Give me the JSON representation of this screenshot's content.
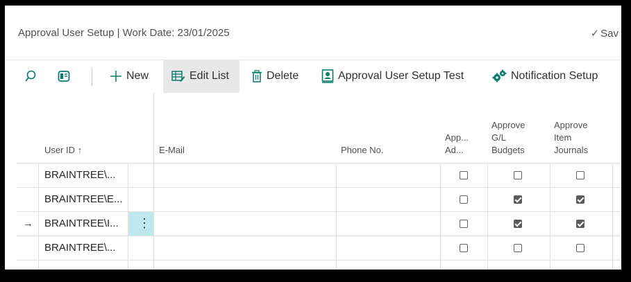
{
  "header": {
    "title": "Approval User Setup | Work Date: 23/01/2025",
    "save_label": "Sav"
  },
  "toolbar": {
    "new_label": "New",
    "edit_list_label": "Edit List",
    "delete_label": "Delete",
    "approval_test_label": "Approval User Setup Test",
    "notification_label": "Notification Setup"
  },
  "grid": {
    "columns": {
      "user_id": "User ID",
      "user_id_sort": "↑",
      "email": "E-Mail",
      "phone": "Phone No.",
      "app_ad_1": "App...",
      "app_ad_2": "Ad...",
      "gl_1": "Approve",
      "gl_2": "G/L",
      "gl_3": "Budgets",
      "item_1": "Approve",
      "item_2": "Item",
      "item_3": "Journals"
    },
    "rows": [
      {
        "user_id": "BRAINTREE\\...",
        "email": "",
        "phone": "",
        "app_ad": false,
        "gl_budgets": false,
        "item_journals": false
      },
      {
        "user_id": "BRAINTREE\\E...",
        "email": "",
        "phone": "",
        "app_ad": false,
        "gl_budgets": true,
        "item_journals": true
      },
      {
        "user_id": "BRAINTREE\\I...",
        "email": "",
        "phone": "",
        "app_ad": false,
        "gl_budgets": true,
        "item_journals": true,
        "current": true
      },
      {
        "user_id": "BRAINTREE\\...",
        "email": "",
        "phone": "",
        "app_ad": false,
        "gl_budgets": false,
        "item_journals": false
      }
    ],
    "current_row_marker": "→",
    "row_menu_glyph": "⋮"
  },
  "colors": {
    "accent": "#0a7a6a",
    "selected_cell": "#bfe7ee"
  }
}
